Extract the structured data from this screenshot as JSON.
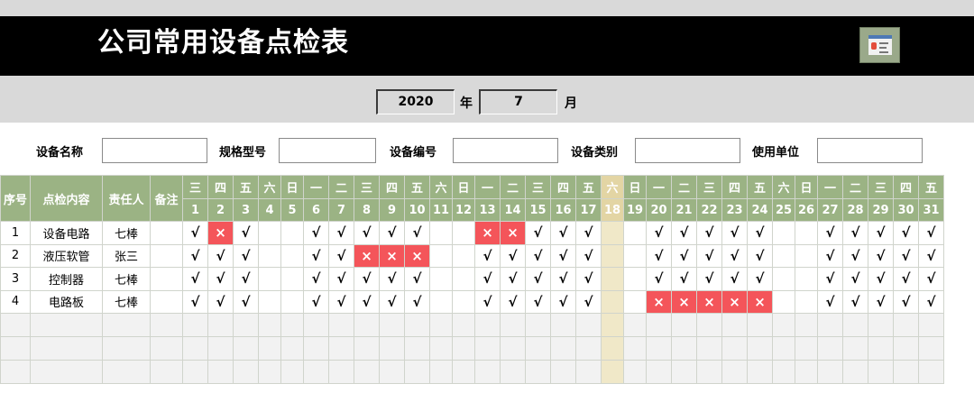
{
  "title": "公司常用设备点检表",
  "icon": "id-card-icon",
  "date": {
    "year": "2020",
    "year_label": "年",
    "month": "7",
    "month_label": "月"
  },
  "info_fields": [
    {
      "label": "设备名称",
      "value": ""
    },
    {
      "label": "规格型号",
      "value": ""
    },
    {
      "label": "设备编号",
      "value": ""
    },
    {
      "label": "设备类别",
      "value": ""
    },
    {
      "label": "使用单位",
      "value": ""
    }
  ],
  "headers": {
    "seq": "序号",
    "content": "点检内容",
    "owner": "责任人",
    "note": "备注"
  },
  "weekdays": [
    "三",
    "四",
    "五",
    "六",
    "日",
    "一",
    "二",
    "三",
    "四",
    "五",
    "六",
    "日",
    "一",
    "二",
    "三",
    "四",
    "五",
    "六",
    "日",
    "一",
    "二",
    "三",
    "四",
    "五",
    "六",
    "日",
    "一",
    "二",
    "三",
    "四",
    "五"
  ],
  "days": [
    "1",
    "2",
    "3",
    "4",
    "5",
    "6",
    "7",
    "8",
    "9",
    "10",
    "11",
    "12",
    "13",
    "14",
    "15",
    "16",
    "17",
    "18",
    "19",
    "20",
    "21",
    "22",
    "23",
    "24",
    "25",
    "26",
    "27",
    "28",
    "29",
    "30",
    "31"
  ],
  "highlight_day": "18",
  "check_mark": "√",
  "fail_mark": "×",
  "rows": [
    {
      "seq": "1",
      "content": "设备电路",
      "owner": "七棒",
      "note": "",
      "checks": "√,×,√,,,√,√,√,√,√,,,×,×,√,√,√,,,√,√,√,√,√,,,√,√,√,√,√"
    },
    {
      "seq": "2",
      "content": "液压软管",
      "owner": "张三",
      "note": "",
      "checks": "√,√,√,,,√,√,×,×,×,,,√,√,√,√,√,,,√,√,√,√,√,,,√,√,√,√,√"
    },
    {
      "seq": "3",
      "content": "控制器",
      "owner": "七棒",
      "note": "",
      "checks": "√,√,√,,,√,√,√,√,√,,,√,√,√,√,√,,,√,√,√,√,√,,,√,√,√,√,√"
    },
    {
      "seq": "4",
      "content": "电路板",
      "owner": "七棒",
      "note": "",
      "checks": "√,√,√,,,√,√,√,√,√,,,√,√,√,√,√,,,×,×,×,×,×,,,√,√,√,√,√"
    }
  ],
  "empty_rows": 3
}
